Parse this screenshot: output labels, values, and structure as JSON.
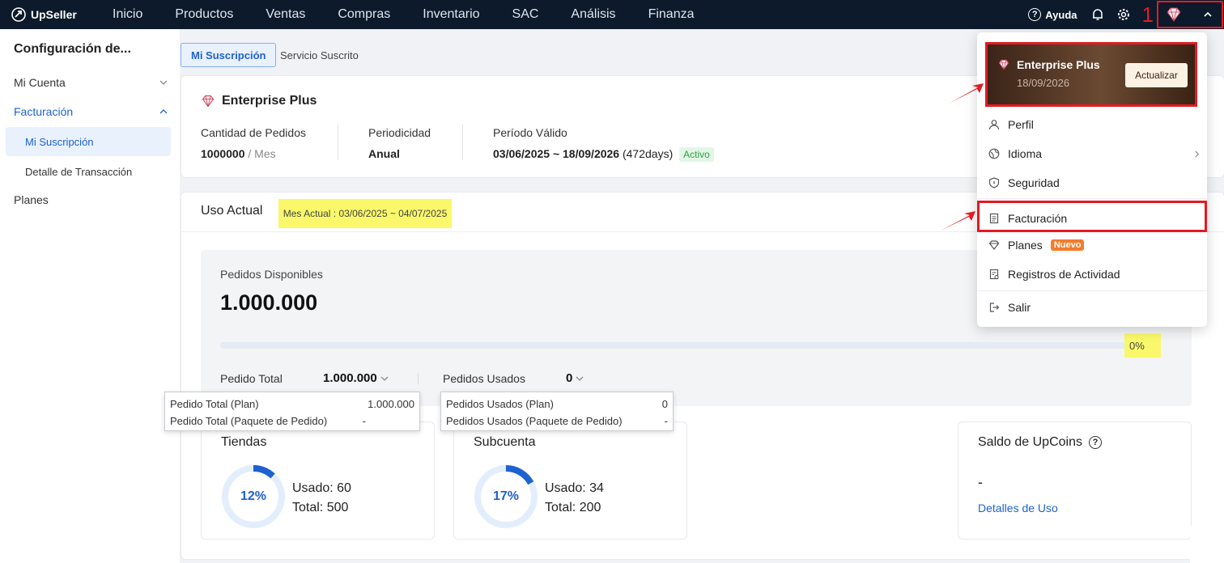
{
  "nav": {
    "brand": "UpSeller",
    "items": [
      "Inicio",
      "Productos",
      "Ventas",
      "Compras",
      "Inventario",
      "SAC",
      "Análisis",
      "Finanza"
    ],
    "help_label": "Ayuda",
    "annotation_number": "1"
  },
  "sidebar": {
    "title": "Configuración de...",
    "mi_cuenta": "Mi Cuenta",
    "facturacion": "Facturación",
    "mi_suscripcion": "Mi Suscripción",
    "detalle": "Detalle de Transacción",
    "planes": "Planes"
  },
  "tabs": {
    "active": "Mi Suscripción",
    "other": "Servicio Suscrito"
  },
  "plan": {
    "name": "Enterprise Plus",
    "orders_label": "Cantidad de Pedidos",
    "orders_value": "1000000",
    "orders_unit": "/ Mes",
    "period_label": "Periodicidad",
    "period_value": "Anual",
    "valid_label": "Período Válido",
    "valid_range": "03/06/2025 ~ 18/09/2026",
    "valid_days": "(472days)",
    "status": "Activo"
  },
  "usage": {
    "title": "Uso Actual",
    "month_range": "Mes Actual : 03/06/2025 ~ 04/07/2025",
    "available_label": "Pedidos Disponibles",
    "available_value": "1.000.000",
    "percent": "0%",
    "percent_fraction": 0,
    "total_label": "Pedido Total",
    "total_value": "1.000.000",
    "used_label": "Pedidos Usados",
    "used_value": "0"
  },
  "tooltip_total": [
    {
      "label": "Pedido Total (Plan)",
      "value": "1.000.000"
    },
    {
      "label": "Pedido Total (Paquete de Pedido)",
      "value": "-"
    }
  ],
  "tooltip_used": [
    {
      "label": "Pedidos Usados (Plan)",
      "value": "0"
    },
    {
      "label": "Pedidos Usados (Paquete de Pedido)",
      "value": "-"
    }
  ],
  "stores": {
    "title": "Tiendas",
    "percent": "12%",
    "fraction": 0.12,
    "used": "Usado: 60",
    "total": "Total: 500"
  },
  "subaccount": {
    "title": "Subcuenta",
    "percent": "17%",
    "fraction": 0.17,
    "used": "Usado: 34",
    "total": "Total: 200"
  },
  "upcoins": {
    "title": "Saldo de UpCoins",
    "value": "-",
    "link": "Detalles de Uso"
  },
  "dropdown": {
    "plan_name": "Enterprise Plus",
    "plan_date": "18/09/2026",
    "update_button": "Actualizar",
    "perfil": "Perfil",
    "idioma": "Idioma",
    "seguridad": "Seguridad",
    "facturacion": "Facturación",
    "planes": "Planes",
    "nuevo": "Nuevo",
    "registros": "Registros de Actividad",
    "salir": "Salir"
  },
  "colors": {
    "accent": "#1e62d0",
    "nav_bg": "#0c1a2b",
    "highlight_red": "#e21b23",
    "highlight_yellow": "#faf86a"
  }
}
